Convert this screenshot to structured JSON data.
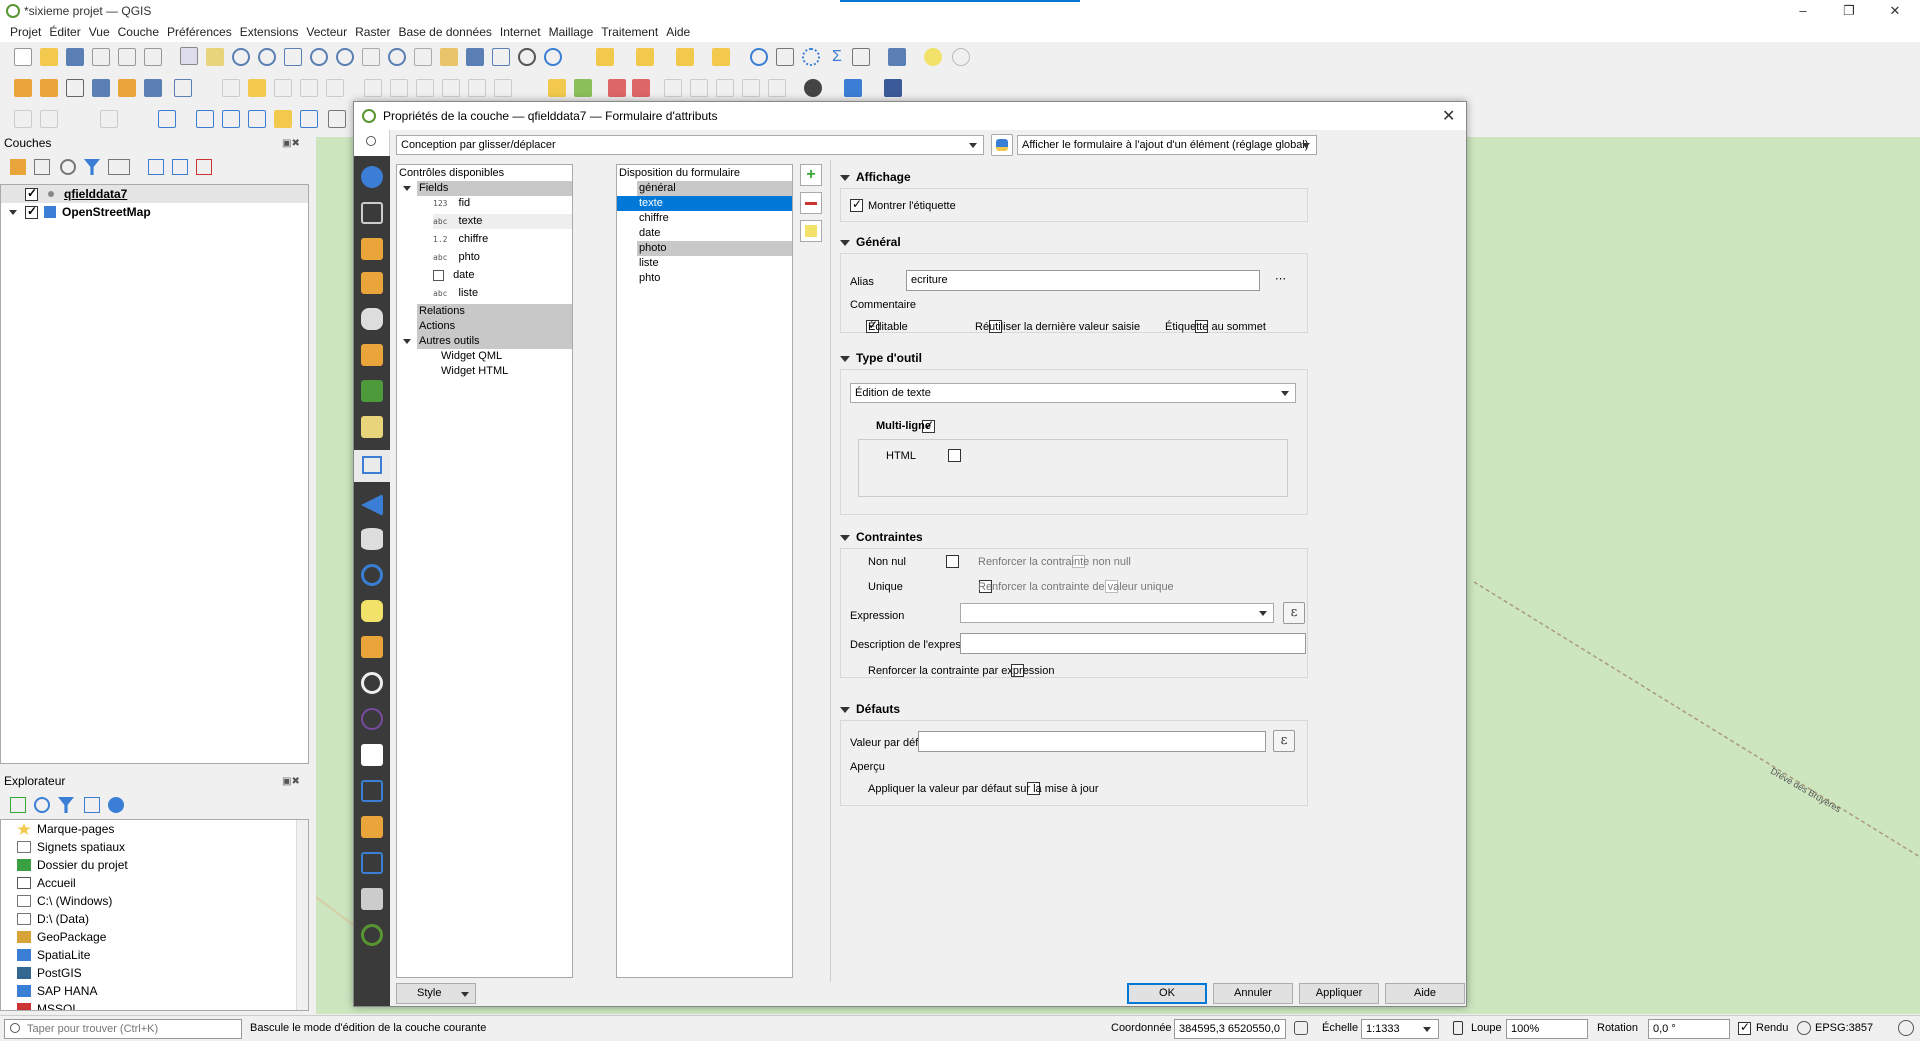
{
  "window": {
    "title": "*sixieme projet — QGIS"
  },
  "menu": [
    "Projet",
    "Éditer",
    "Vue",
    "Couche",
    "Préférences",
    "Extensions",
    "Vecteur",
    "Raster",
    "Base de données",
    "Internet",
    "Maillage",
    "Traitement",
    "Aide"
  ],
  "layers_panel": {
    "title": "Couches",
    "layers": [
      {
        "name": "qfielddata7",
        "checked": true
      },
      {
        "name": "OpenStreetMap",
        "checked": true
      }
    ]
  },
  "browser_panel": {
    "title": "Explorateur",
    "items": [
      "Marque-pages",
      "Signets spatiaux",
      "Dossier du projet",
      "Accueil",
      "C:\\ (Windows)",
      "D:\\ (Data)",
      "GeoPackage",
      "SpatiaLite",
      "PostGIS",
      "SAP HANA",
      "MSSQL"
    ]
  },
  "map": {
    "road_label": "Drève des Bruyères"
  },
  "status": {
    "search_placeholder": "Taper pour trouver (Ctrl+K)",
    "message": "Bascule le mode d'édition de la couche courante",
    "coord_label": "Coordonnée",
    "coord_value": "384595,3 6520550,0",
    "scale_label": "Échelle",
    "scale_value": "1:1333",
    "magnifier_label": "Loupe",
    "magnifier_value": "100%",
    "rotation_label": "Rotation",
    "rotation_value": "0,0 °",
    "render_label": "Rendu",
    "crs": "EPSG:3857"
  },
  "dialog": {
    "title": "Propriétés de la couche — qfielddata7 — Formulaire d'attributs",
    "designer_mode": "Conception par glisser/déplacer",
    "form_suppress": "Afficher le formulaire à l'ajout d'un élément (réglage global)",
    "available_title": "Contrôles disponibles",
    "fields_group": "Fields",
    "fields": [
      {
        "type": "123",
        "name": "fid"
      },
      {
        "type": "abc",
        "name": "texte"
      },
      {
        "type": "1.2",
        "name": "chiffre"
      },
      {
        "type": "abc",
        "name": "phto"
      },
      {
        "type": "cal",
        "name": "date"
      },
      {
        "type": "abc",
        "name": "liste"
      }
    ],
    "relations": "Relations",
    "actions": "Actions",
    "other_tools": "Autres outils",
    "widgets": [
      "Widget QML",
      "Widget HTML"
    ],
    "layout_title": "Disposition du formulaire",
    "layout_items": [
      "général",
      "texte",
      "chiffre",
      "date",
      "photo",
      "liste",
      "phto"
    ],
    "display_section": "Affichage",
    "show_label": "Montrer l'étiquette",
    "general_section": "Général",
    "alias_label": "Alias",
    "alias_value": "ecriture",
    "comment_label": "Commentaire",
    "editable": "Éditable",
    "reuse_last": "Réutiliser la dernière valeur saisie",
    "label_on_top": "Étiquette au sommet",
    "widget_section": "Type d'outil",
    "widget_type": "Édition de texte",
    "multiline": "Multi-ligne",
    "html": "HTML",
    "constraints_section": "Contraintes",
    "not_null": "Non nul",
    "enforce_not_null": "Renforcer la contrainte non null",
    "unique": "Unique",
    "enforce_unique": "Renforcer la contrainte de valeur unique",
    "expression_label": "Expression",
    "expression_desc_label": "Description de l'expression",
    "enforce_expression": "Renforcer la contrainte par expression",
    "defaults_section": "Défauts",
    "default_value_label": "Valeur par défaut",
    "preview_label": "Aperçu",
    "apply_default_on_update": "Appliquer la valeur par défaut sur la mise à jour",
    "style_button": "Style",
    "ok": "OK",
    "cancel": "Annuler",
    "apply": "Appliquer",
    "help": "Aide"
  }
}
